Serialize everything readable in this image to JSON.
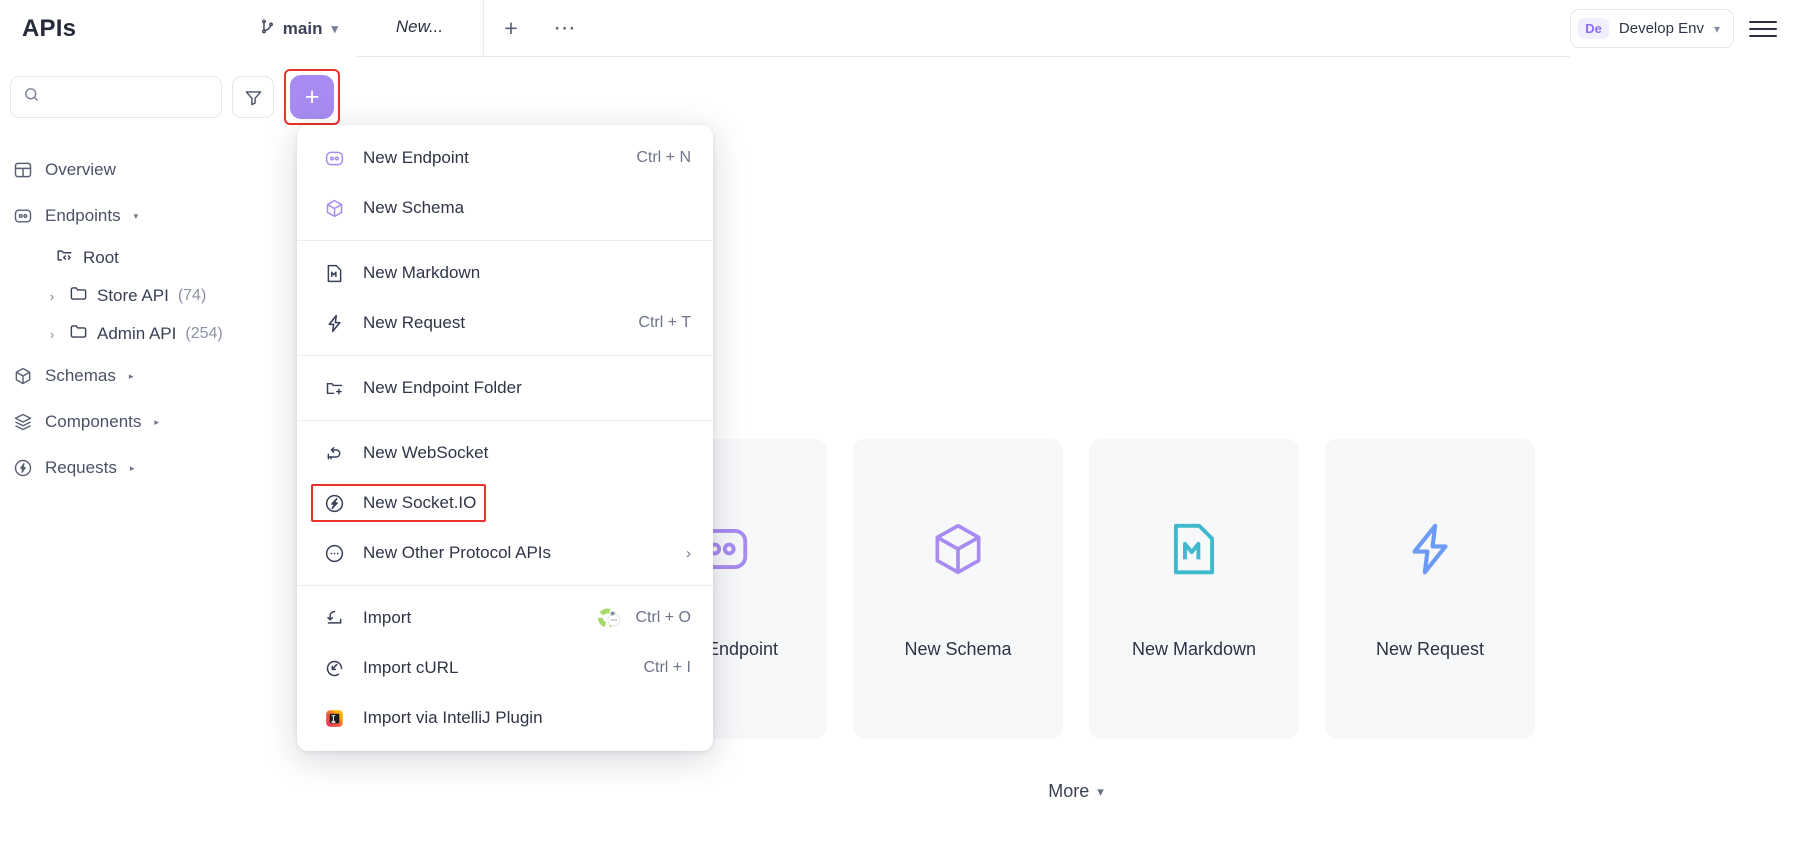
{
  "header": {
    "app_title": "APIs",
    "branch_name": "main",
    "tab_label": "New...",
    "add_tab_label": "+",
    "more_tabs_label": "⋯",
    "env_badge": "De",
    "env_label": "Develop Env"
  },
  "sidebar": {
    "search_placeholder": "",
    "search_value": "",
    "add_button_label": "+",
    "nav": [
      {
        "label": "Overview",
        "icon": "overview-icon",
        "caret": ""
      },
      {
        "label": "Endpoints",
        "icon": "endpoints-icon",
        "caret": "▾"
      },
      {
        "label": "Schemas",
        "icon": "schemas-icon",
        "caret": "▸"
      },
      {
        "label": "Components",
        "icon": "components-icon",
        "caret": "▸"
      },
      {
        "label": "Requests",
        "icon": "requests-icon",
        "caret": "▸"
      }
    ],
    "tree": [
      {
        "label": "Root",
        "count": "",
        "icon": "root-folder-icon",
        "twisty": ""
      },
      {
        "label": "Store API",
        "count": "(74)",
        "icon": "folder-icon",
        "twisty": "›"
      },
      {
        "label": "Admin API",
        "count": "(254)",
        "icon": "folder-icon",
        "twisty": "›"
      }
    ]
  },
  "menu": {
    "groups": [
      {
        "items": [
          {
            "label": "New Endpoint",
            "shortcut": "Ctrl + N",
            "icon": "endpoint-icon",
            "highlighted": false,
            "arrow": ""
          },
          {
            "label": "New Schema",
            "shortcut": "",
            "icon": "schema-cube-icon",
            "highlighted": false,
            "arrow": ""
          }
        ]
      },
      {
        "items": [
          {
            "label": "New Markdown",
            "shortcut": "",
            "icon": "markdown-icon",
            "highlighted": false,
            "arrow": ""
          },
          {
            "label": "New Request",
            "shortcut": "Ctrl + T",
            "icon": "lightning-icon",
            "highlighted": false,
            "arrow": ""
          }
        ]
      },
      {
        "items": [
          {
            "label": "New Endpoint Folder",
            "shortcut": "",
            "icon": "folder-plus-icon",
            "highlighted": false,
            "arrow": ""
          }
        ]
      },
      {
        "items": [
          {
            "label": "New WebSocket",
            "shortcut": "",
            "icon": "websocket-icon",
            "highlighted": false,
            "arrow": ""
          },
          {
            "label": "New Socket.IO",
            "shortcut": "",
            "icon": "socketio-icon",
            "highlighted": true,
            "arrow": ""
          },
          {
            "label": "New Other Protocol APIs",
            "shortcut": "",
            "icon": "dots-circle-icon",
            "highlighted": false,
            "arrow": "›"
          }
        ]
      },
      {
        "items": [
          {
            "label": "Import",
            "shortcut": "Ctrl + O",
            "icon": "import-icon",
            "highlighted": false,
            "arrow": ""
          },
          {
            "label": "Import cURL",
            "shortcut": "Ctrl + I",
            "icon": "curl-icon",
            "highlighted": false,
            "arrow": ""
          },
          {
            "label": "Import via IntelliJ Plugin",
            "shortcut": "",
            "icon": "intellij-icon",
            "highlighted": false,
            "arrow": ""
          }
        ]
      }
    ]
  },
  "main": {
    "cards": [
      {
        "label": "New Endpoint",
        "icon": "endpoint-icon"
      },
      {
        "label": "New Schema",
        "icon": "schema-cube-icon"
      },
      {
        "label": "New Markdown",
        "icon": "markdown-icon"
      },
      {
        "label": "New Request",
        "icon": "lightning-icon"
      }
    ],
    "more_label": "More"
  },
  "colors": {
    "accent_purple": "#a88bf0",
    "highlight_red": "#e8322b",
    "markdown_teal": "#3fb9cd",
    "request_blue": "#6b9bf5"
  }
}
